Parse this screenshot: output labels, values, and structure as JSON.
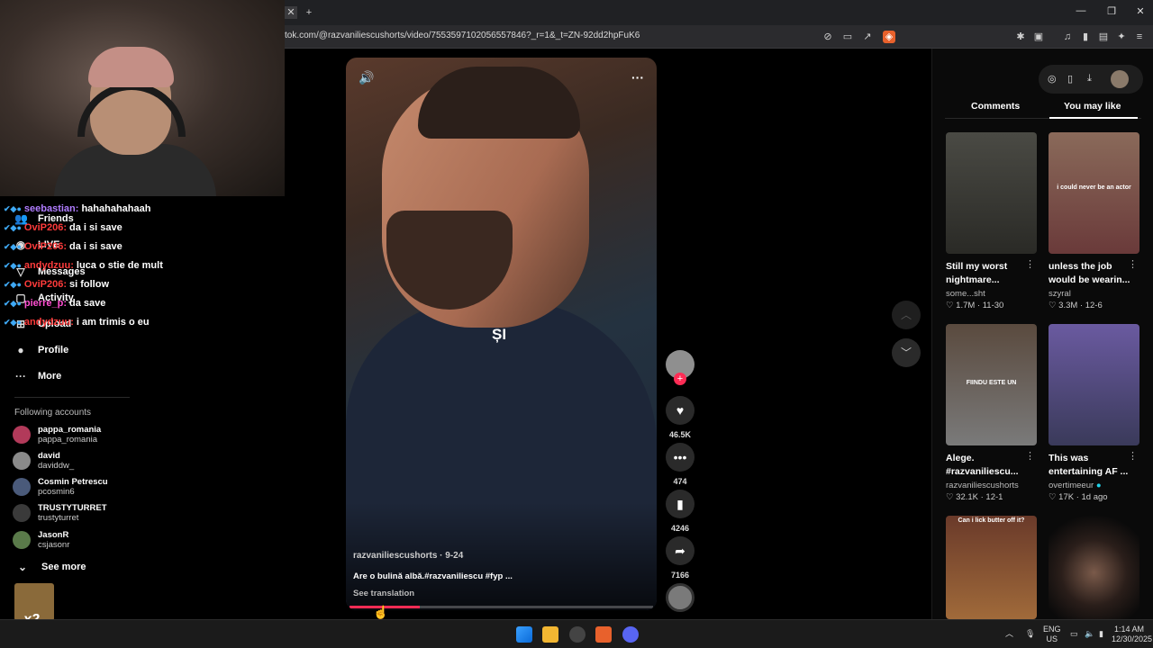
{
  "browser": {
    "new_tab": "+",
    "url": "tok.com/@razvaniliescushorts/video/7553597102056557846?_r=1&_t=ZN-92dd2hpFuK6",
    "window_controls": [
      "—",
      "❐",
      "✕"
    ]
  },
  "sidebar": {
    "nav": [
      {
        "label": "Friends",
        "icon": "friends-icon"
      },
      {
        "label": "LIVE",
        "icon": "live-icon"
      },
      {
        "label": "Messages",
        "icon": "messages-icon"
      },
      {
        "label": "Activity",
        "icon": "activity-icon"
      },
      {
        "label": "Upload",
        "icon": "upload-icon"
      },
      {
        "label": "Profile",
        "icon": "profile-icon"
      },
      {
        "label": "More",
        "icon": "more-icon"
      }
    ],
    "chat": [
      {
        "user": "seebastian:",
        "text": "hahahahahaah",
        "color": "#b07cff"
      },
      {
        "user": "OviP206:",
        "text": "da i si save",
        "color": "#ff3b3b"
      },
      {
        "user": "OviP206:",
        "text": "da i si save",
        "color": "#ff3b3b"
      },
      {
        "user": "andydzuu:",
        "text": "luca o stie de mult",
        "color": "#ff3b3b"
      },
      {
        "user": "OviP206:",
        "text": "si follow",
        "color": "#ff3b3b"
      },
      {
        "user": "pierre_p:",
        "text": "da save",
        "color": "#ff4fd2"
      },
      {
        "user": "andydzuu:",
        "text": "i am trimis o eu",
        "color": "#ff3b3b"
      }
    ],
    "following_label": "Following accounts",
    "accounts": [
      {
        "name": "pappa_romania",
        "handle": "pappa_romania"
      },
      {
        "name": "david",
        "handle": "daviddw_"
      },
      {
        "name": "Cosmin Petrescu",
        "handle": "pcosmin6"
      },
      {
        "name": "TRUSTYTURRET",
        "handle": "trustyturret"
      },
      {
        "name": "JasonR",
        "handle": "csjasonr"
      }
    ],
    "see_more": "See more",
    "emote_label": "x2"
  },
  "video": {
    "caption_word": "ȘI",
    "author": "razvaniliescushorts · 9-24",
    "description": "Are o bulină albă.#razvaniliescu #fyp ...",
    "see_translation": "See translation",
    "progress": 0.23
  },
  "actions": {
    "likes": "46.5K",
    "comments": "474",
    "saves": "4246",
    "shares": "7166"
  },
  "right_panel": {
    "tabs": [
      "Comments",
      "You may like"
    ],
    "active_tab": "You may like",
    "cards": [
      {
        "title": "Still my worst nightmare...",
        "author": "some...sht",
        "meta": "♡ 1.7M · 11-30",
        "thumb_text": ""
      },
      {
        "title": "unless the job would be wearin...",
        "author": "szyral",
        "meta": "♡ 3.3M · 12-6",
        "thumb_text": "i could never be an actor"
      },
      {
        "title": "Alege. #razvaniliescu...",
        "author": "razvaniliescushorts",
        "meta": "♡ 32.1K · 12-1",
        "thumb_text": "FIINDU ESTE UN"
      },
      {
        "title": "This was entertaining AF ...",
        "author": "overtimeeur",
        "meta": "♡ 17K · 1d ago",
        "thumb_text": ""
      },
      {
        "title": "",
        "author": "",
        "meta": "",
        "thumb_text": "Can i lick butter off it?"
      },
      {
        "title": "",
        "author": "",
        "meta": "",
        "thumb_text": ""
      }
    ]
  },
  "taskbar": {
    "lang": "ENG",
    "region": "US",
    "time": "1:14 AM",
    "date": "12/30/2025"
  }
}
